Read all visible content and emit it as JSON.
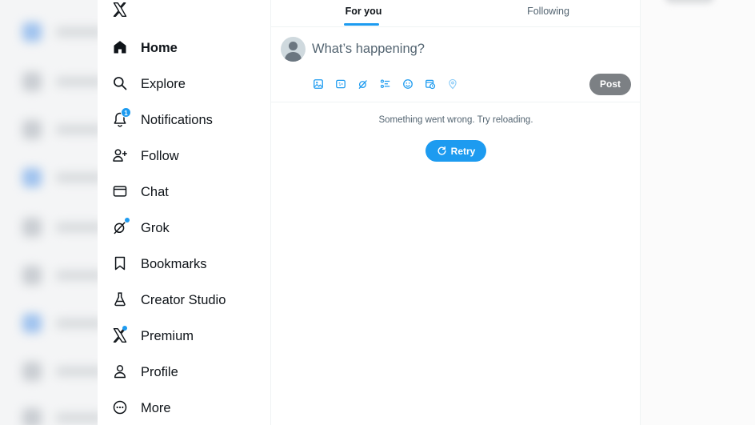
{
  "sidebar": {
    "logo": "x-logo-icon",
    "items": [
      {
        "label": "Home",
        "icon": "home-icon",
        "active": true
      },
      {
        "label": "Explore",
        "icon": "search-icon"
      },
      {
        "label": "Notifications",
        "icon": "bell-icon",
        "badge": "1"
      },
      {
        "label": "Follow",
        "icon": "person-add-icon"
      },
      {
        "label": "Chat",
        "icon": "envelope-icon"
      },
      {
        "label": "Grok",
        "icon": "grok-icon"
      },
      {
        "label": "Bookmarks",
        "icon": "bookmark-icon"
      },
      {
        "label": "Creator Studio",
        "icon": "flask-icon"
      },
      {
        "label": "Premium",
        "icon": "x-premium-icon"
      },
      {
        "label": "Profile",
        "icon": "person-icon"
      },
      {
        "label": "More",
        "icon": "more-circle-icon"
      }
    ]
  },
  "main": {
    "tabs": [
      {
        "label": "For you",
        "active": true
      },
      {
        "label": "Following",
        "active": false
      }
    ],
    "composer": {
      "placeholder": "What’s happening?",
      "post_label": "Post",
      "tools": [
        "image-icon",
        "gif-icon",
        "grok-icon",
        "poll-icon",
        "emoji-icon",
        "schedule-icon",
        "location-icon"
      ]
    },
    "error": {
      "message": "Something went wrong. Try reloading.",
      "retry_label": "Retry"
    }
  },
  "colors": {
    "accent": "#1d9bf0",
    "text": "#0f1419",
    "secondary_text": "#536471",
    "post_disabled": "#7c8084"
  }
}
